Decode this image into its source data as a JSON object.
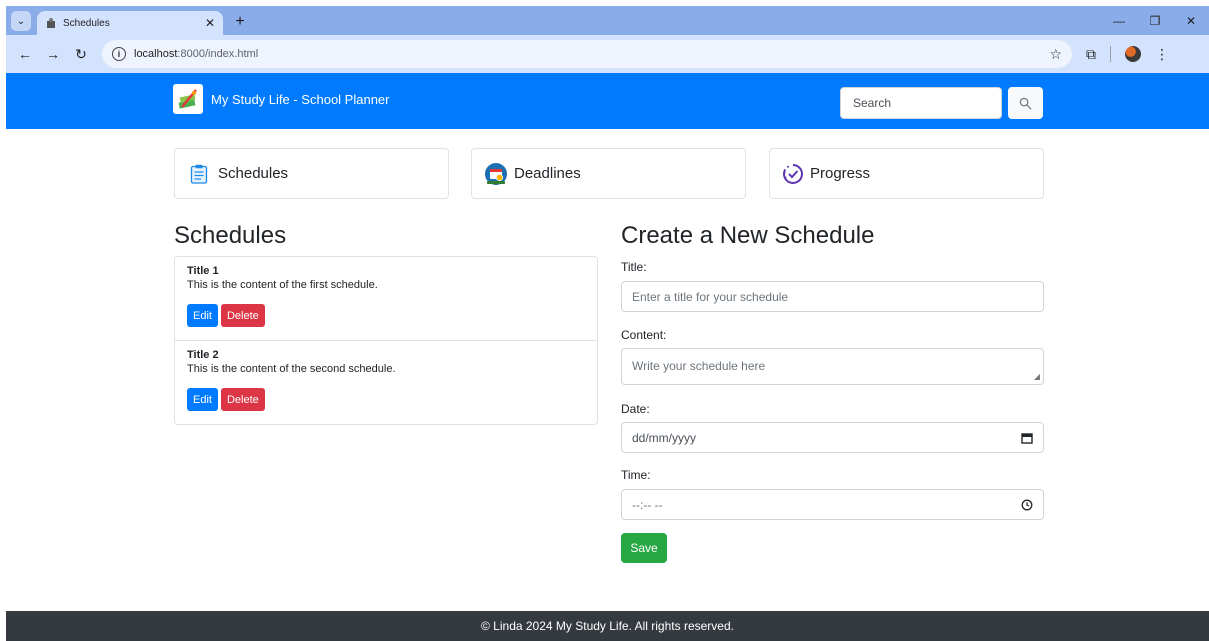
{
  "browser": {
    "tab_title": "Schedules",
    "url_host": "localhost",
    "url_path": ":8000/index.html"
  },
  "navbar": {
    "brand": "My Study Life - School Planner",
    "search_placeholder": "Search"
  },
  "cards": [
    {
      "label": "Schedules",
      "icon": "clipboard-icon"
    },
    {
      "label": "Deadlines",
      "icon": "calendar-clock-icon"
    },
    {
      "label": "Progress",
      "icon": "progress-check-icon"
    }
  ],
  "schedules": {
    "heading": "Schedules",
    "items": [
      {
        "title": "Title 1",
        "content": "This is the content of the first schedule.",
        "edit_label": "Edit",
        "delete_label": "Delete"
      },
      {
        "title": "Title 2",
        "content": "This is the content of the second schedule.",
        "edit_label": "Edit",
        "delete_label": "Delete"
      }
    ]
  },
  "form": {
    "heading": "Create a New Schedule",
    "title_label": "Title:",
    "title_placeholder": "Enter a title for your schedule",
    "content_label": "Content:",
    "content_placeholder": "Write your schedule here",
    "date_label": "Date:",
    "date_placeholder": "dd/mm/yyyy",
    "time_label": "Time:",
    "time_placeholder": "--:-- --",
    "save_label": "Save"
  },
  "footer": {
    "text": "© Linda 2024 My Study Life. All rights reserved."
  },
  "colors": {
    "primary": "#007bff",
    "danger": "#dc3545",
    "success": "#28a745",
    "footer_bg": "#343a40"
  }
}
